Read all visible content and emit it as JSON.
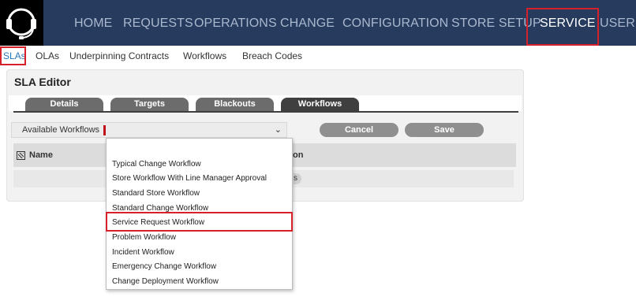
{
  "nav": {
    "items": [
      {
        "label": "HOME"
      },
      {
        "label": "REQUESTS"
      },
      {
        "label": "OPERATIONS"
      },
      {
        "label": "CHANGE"
      },
      {
        "label": "CONFIGURATION"
      },
      {
        "label": "STORE SETUP"
      },
      {
        "label": "SERVICE"
      },
      {
        "label": "USER"
      }
    ],
    "active": "SERVICE"
  },
  "subnav": {
    "items": [
      {
        "label": "SLAs"
      },
      {
        "label": "OLAs"
      },
      {
        "label": "Underpinning Contracts"
      },
      {
        "label": "Workflows"
      },
      {
        "label": "Breach Codes"
      }
    ],
    "active": "SLAs"
  },
  "editor": {
    "title": "SLA Editor",
    "tabs": [
      {
        "label": "Details"
      },
      {
        "label": "Targets"
      },
      {
        "label": "Blackouts"
      },
      {
        "label": "Workflows"
      }
    ],
    "active_tab": "Workflows",
    "workflow_select": {
      "label": "Available Workflows",
      "value": ""
    },
    "buttons": {
      "cancel": "Cancel",
      "save": "Save"
    },
    "grid": {
      "col_name": "Name",
      "col_other_visible": "on",
      "row_pill": "s"
    }
  },
  "dropdown": {
    "options": [
      "",
      "Typical Change Workflow",
      "Store Workflow With Line Manager Approval",
      "Standard Store Workflow",
      "Standard Change Workflow",
      "Service Request Workflow",
      "Problem Workflow",
      "Incident Workflow",
      "Emergency Change Workflow",
      "Change Deployment Workflow"
    ],
    "highlighted": "Service Request Workflow"
  },
  "colors": {
    "nav_bg": "#263b5e",
    "nav_text": "#aab8ce",
    "highlight_red": "#d6202a",
    "tab_bg": "#6c6c6c",
    "tab_active_bg": "#3f3f3f",
    "button_bg": "#8f8f8f"
  }
}
